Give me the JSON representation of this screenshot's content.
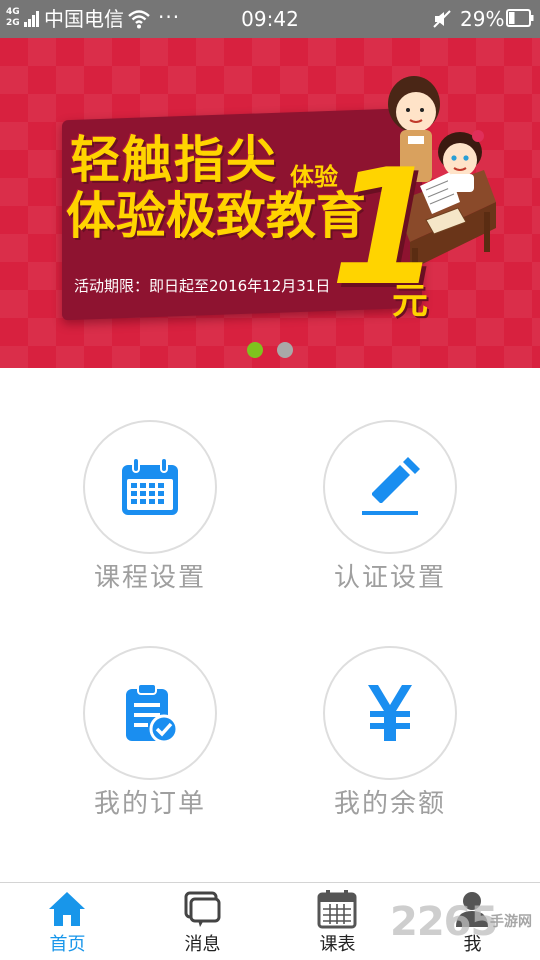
{
  "status_bar": {
    "network_top": "4G",
    "network_bottom": "2G",
    "carrier": "中国电信",
    "more": "···",
    "time": "09:42",
    "battery_percent": "29%",
    "battery_level": 0.29,
    "icons": [
      "signal-icon",
      "wifi-icon",
      "mute-icon",
      "battery-icon"
    ]
  },
  "banner": {
    "headline_line1": "轻触指尖",
    "headline_line2": "体验极致教育",
    "tag": "体验",
    "price": "1",
    "unit": "元",
    "period": "活动期限：即日起至2016年12月31日",
    "slides_total": 2,
    "active_slide": 1,
    "colors": {
      "background": "#d8213f",
      "headline": "#ffd400",
      "dot_active": "#7ec31e",
      "dot_inactive": "#a9a9a9"
    }
  },
  "features": [
    {
      "label": "课程设置",
      "icon": "calendar-icon"
    },
    {
      "label": "认证设置",
      "icon": "pencil-icon"
    },
    {
      "label": "我的订单",
      "icon": "clipboard-check-icon"
    },
    {
      "label": "我的余额",
      "icon": "yen-icon"
    }
  ],
  "tabs": [
    {
      "label": "首页",
      "icon": "home-icon",
      "active": true
    },
    {
      "label": "消息",
      "icon": "message-icon",
      "active": false
    },
    {
      "label": "课表",
      "icon": "calendar-icon",
      "active": false
    },
    {
      "label": "我",
      "icon": "user-icon",
      "active": false
    }
  ],
  "watermark": {
    "number": "2265",
    "site": "手游网"
  },
  "colors": {
    "accent": "#1896ea",
    "icon_blue": "#1a8ef0",
    "label_gray": "#9f9f9f",
    "status_bar": "#767676"
  }
}
